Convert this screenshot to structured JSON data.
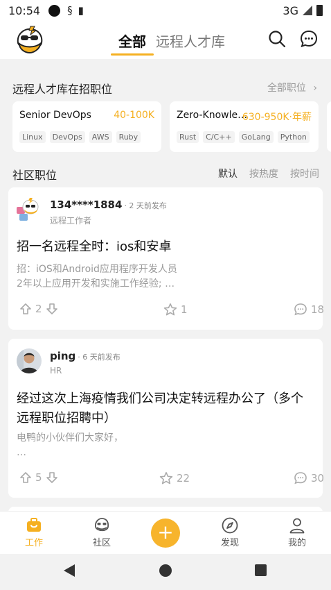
{
  "status": {
    "time": "10:54",
    "network": "3G"
  },
  "header": {
    "tabs": [
      {
        "label": "全部",
        "active": true
      },
      {
        "label": "远程人才库",
        "active": false
      }
    ],
    "icons": [
      "search-icon",
      "message-icon"
    ]
  },
  "talent": {
    "title": "远程人才库在招职位",
    "all_jobs": "全部职位",
    "jobs": [
      {
        "title": "Senior DevOps",
        "salary": "40-100K",
        "tags": [
          "Linux",
          "DevOps",
          "AWS",
          "Ruby"
        ]
      },
      {
        "title": "Zero-Knowled…",
        "salary": "630-950K·年薪",
        "tags": [
          "Rust",
          "C/C++",
          "GoLang",
          "Python"
        ]
      }
    ]
  },
  "community": {
    "title": "社区职位",
    "sort": [
      "默认",
      "按热度",
      "按时间"
    ],
    "posts": [
      {
        "author": "134****1884",
        "posted": "· 2 天前发布",
        "role": "远程工作者",
        "title": "招一名远程全时：ios和安卓",
        "excerpt": [
          "招：iOS和Android应用程序开发人员",
          "2年以上应用开发和实施工作经验; …"
        ],
        "votes": "2",
        "stars": "1",
        "comments": "18"
      },
      {
        "author": "ping",
        "posted": "· 6 天前发布",
        "role": "HR",
        "title": "经过这次上海疫情我们公司决定转远程办公了（多个远程职位招聘中）",
        "excerpt": [
          "电鸭的小伙伴们大家好，",
          "…"
        ],
        "votes": "5",
        "stars": "22",
        "comments": "30"
      }
    ]
  },
  "nav": [
    {
      "label": "工作",
      "icon": "briefcase-icon",
      "active": true
    },
    {
      "label": "社区",
      "icon": "duck-icon",
      "active": false
    },
    {
      "label": "发现",
      "icon": "compass-icon",
      "active": false
    },
    {
      "label": "我的",
      "icon": "profile-icon",
      "active": false
    }
  ],
  "fab": "+",
  "colors": {
    "accent": "#f5b021",
    "background": "#f2f2f2"
  }
}
